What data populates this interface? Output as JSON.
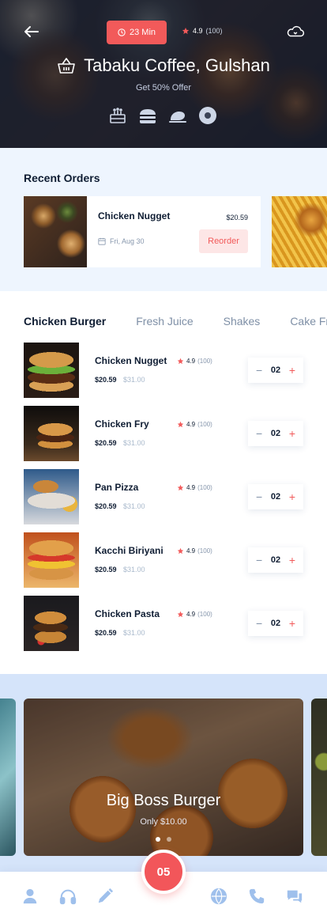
{
  "header": {
    "delivery_time": "23 Min",
    "rating": "4.9",
    "rating_count": "(100)",
    "restaurant_name": "Tabaku Coffee, Gulshan",
    "offer": "Get 50% Offer",
    "category_icons": [
      "cake-icon",
      "burger-icon",
      "chicken-icon",
      "donut-icon"
    ]
  },
  "recent_orders": {
    "title": "Recent Orders",
    "orders": [
      {
        "name": "Chicken Nugget",
        "price": "$20.59",
        "date": "Fri, Aug 30",
        "action": "Reorder"
      }
    ]
  },
  "menu": {
    "tabs": [
      "Chicken Burger",
      "Fresh Juice",
      "Shakes",
      "Cake Fr"
    ],
    "active_tab": 0,
    "items": [
      {
        "name": "Chicken Nugget",
        "rating": "4.9",
        "rating_count": "(100)",
        "price": "$20.59",
        "old_price": "$31.00",
        "qty": "02"
      },
      {
        "name": "Chicken Fry",
        "rating": "4.9",
        "rating_count": "(100)",
        "price": "$20.59",
        "old_price": "$31.00",
        "qty": "02"
      },
      {
        "name": "Pan Pizza",
        "rating": "4.9",
        "rating_count": "(100)",
        "price": "$20.59",
        "old_price": "$31.00",
        "qty": "02"
      },
      {
        "name": "Kacchi Biriyani",
        "rating": "4.9",
        "rating_count": "(100)",
        "price": "$20.59",
        "old_price": "$31.00",
        "qty": "02"
      },
      {
        "name": "Chicken Pasta",
        "rating": "4.9",
        "rating_count": "(100)",
        "price": "$20.59",
        "old_price": "$31.00",
        "qty": "02"
      }
    ],
    "stepper": {
      "minus": "−",
      "plus": "+"
    }
  },
  "promo": {
    "title": "Big Boss Burger",
    "subtitle": "Only $10.00",
    "active_dot": 0
  },
  "bottom_nav": {
    "cart_count": "05",
    "icons": [
      "user-icon",
      "headphones-icon",
      "pencil-icon",
      "globe-icon",
      "phone-icon",
      "chat-icon"
    ]
  },
  "colors": {
    "accent": "#f25a5a",
    "primary_text": "#0f1d33",
    "muted_text": "#7e8fa6",
    "nav_icon": "#9fc0ec"
  }
}
